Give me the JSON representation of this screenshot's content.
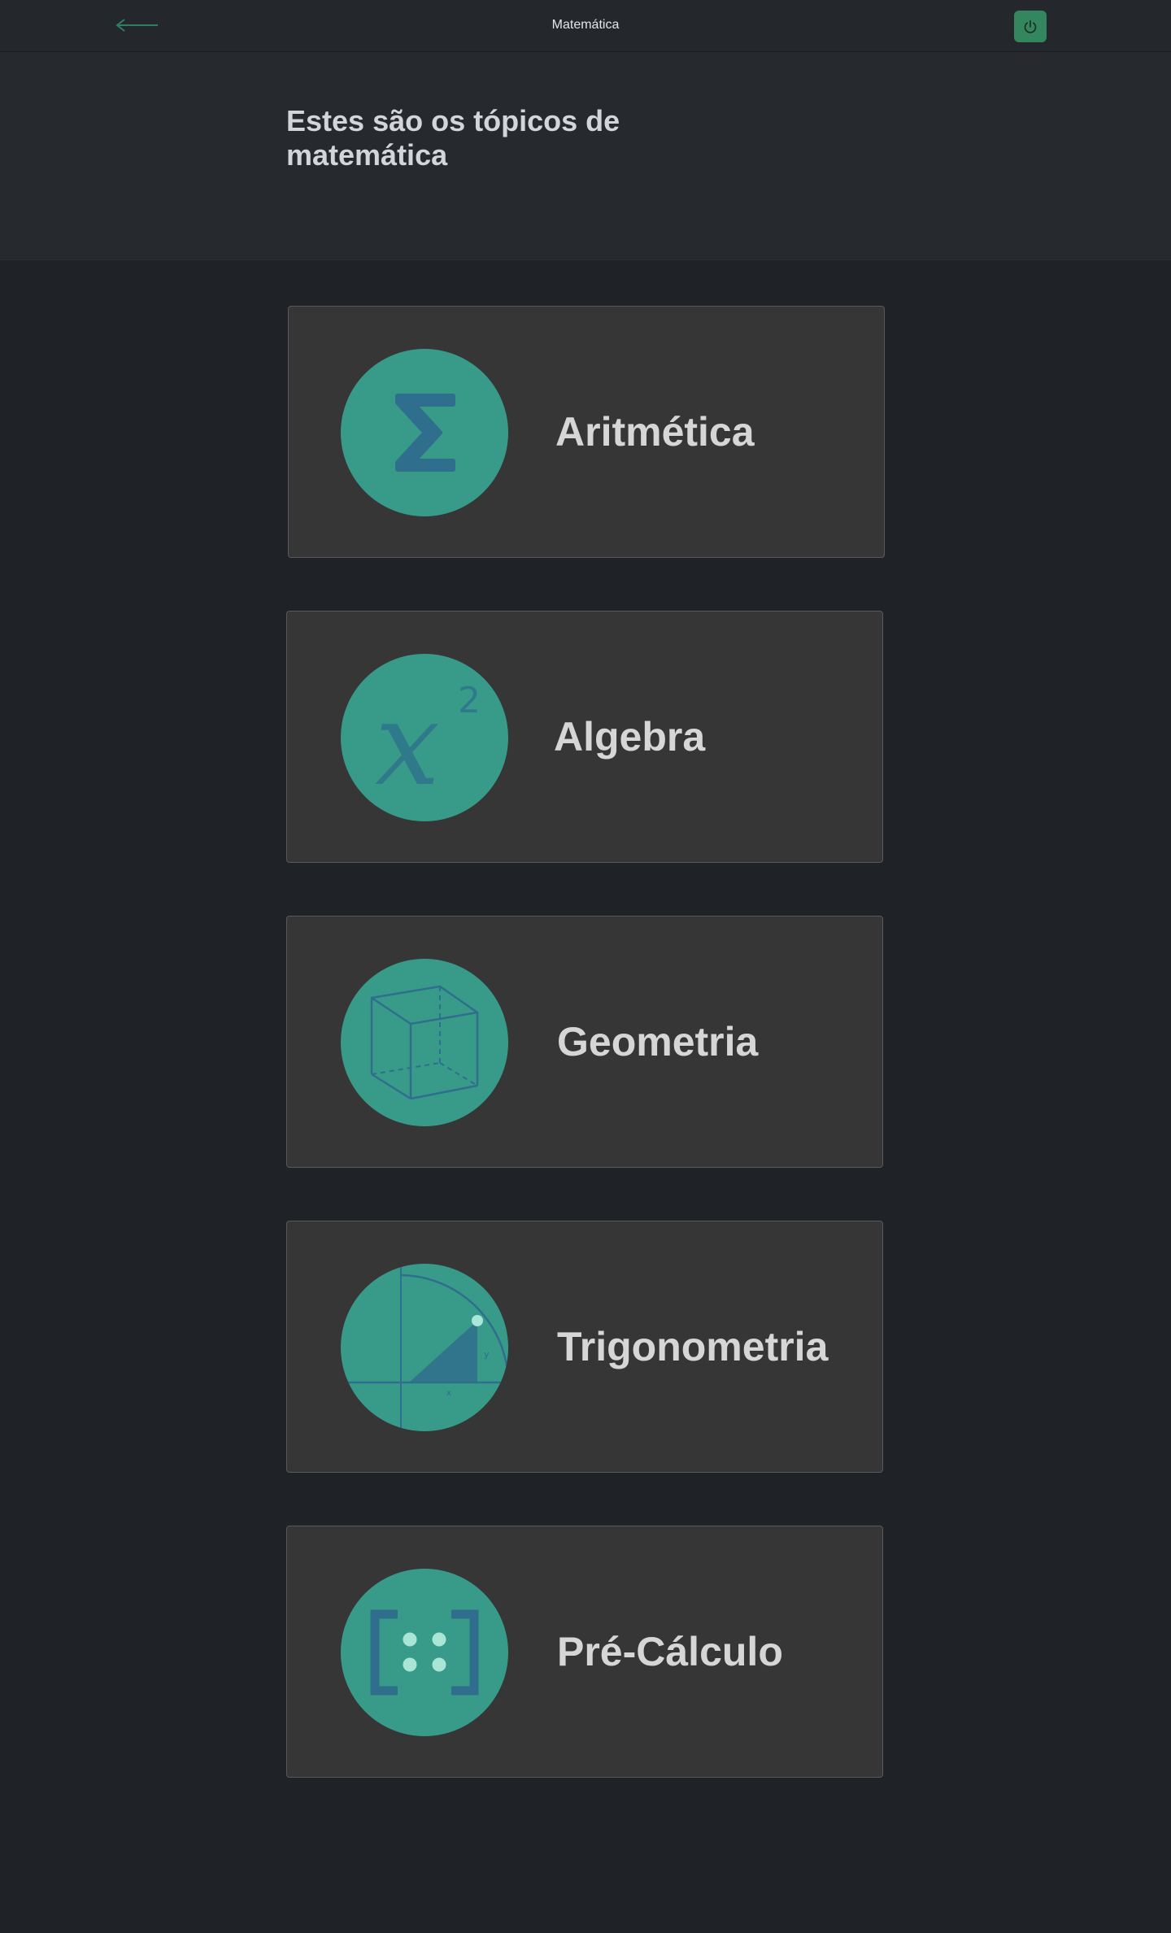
{
  "header": {
    "back_icon": "arrow-left-icon",
    "title": "Matemática",
    "power_icon": "power-icon",
    "accent_color": "#33865d"
  },
  "hero": {
    "title": "Estes são os tópicos de matemática"
  },
  "topics": [
    {
      "label": "Aritmética",
      "icon": "sigma-icon"
    },
    {
      "label": "Algebra",
      "icon": "x-squared-icon"
    },
    {
      "label": "Geometria",
      "icon": "cube-icon"
    },
    {
      "label": "Trigonometria",
      "icon": "unit-circle-icon"
    },
    {
      "label": "Pré-Cálculo",
      "icon": "matrix-icon"
    }
  ],
  "colors": {
    "page_background": "#1f2226",
    "card_background": "#363636",
    "icon_circle": "#389b8a",
    "icon_stroke": "#2f6e8c"
  }
}
